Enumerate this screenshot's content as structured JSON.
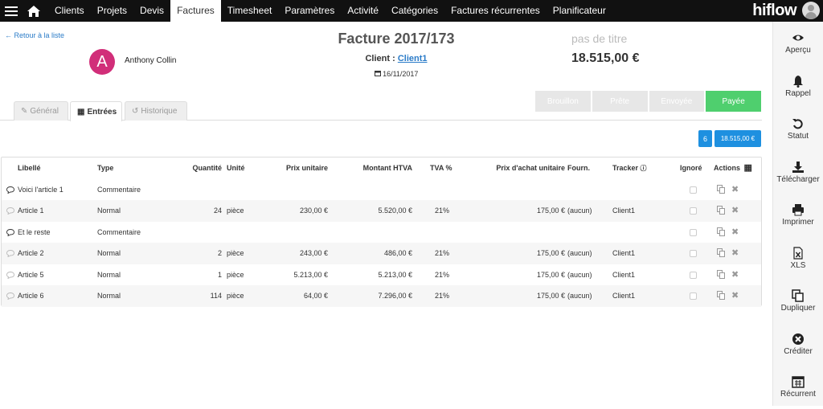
{
  "nav": {
    "tabs": [
      {
        "label": "Clients"
      },
      {
        "label": "Projets"
      },
      {
        "label": "Devis"
      },
      {
        "label": "Factures",
        "active": true
      },
      {
        "label": "Timesheet"
      },
      {
        "label": "Paramètres"
      },
      {
        "label": "Activité"
      },
      {
        "label": "Catégories"
      },
      {
        "label": "Factures récurrentes"
      },
      {
        "label": "Planificateur"
      }
    ],
    "brand": "hiflow"
  },
  "header": {
    "back_label": "Retour à la liste",
    "avatar_letter": "A",
    "contact_name": "Anthony Collin",
    "title": "Facture 2017/173",
    "client_label": "Client :",
    "client_link": "Client1",
    "date": "16/11/2017",
    "no_title": "pas de titre",
    "total": "18.515,00 €"
  },
  "status_steps": [
    {
      "label": "Brouillon",
      "active": false
    },
    {
      "label": "Prête",
      "active": false
    },
    {
      "label": "Envoyée",
      "active": false
    },
    {
      "label": "Payée",
      "active": true
    }
  ],
  "subtabs": {
    "general": "Général",
    "entries": "Entrées",
    "history": "Historique"
  },
  "summary": {
    "count": "6",
    "sum": "18.515,00 €"
  },
  "table": {
    "headers": {
      "libelle": "Libellé",
      "type": "Type",
      "quantite": "Quantité",
      "unite": "Unité",
      "prix_unitaire": "Prix unitaire",
      "montant": "Montant HTVA",
      "tva": "TVA %",
      "prix_achat": "Prix d'achat unitaire",
      "fourn": "Fourn.",
      "tracker": "Tracker",
      "ignore": "Ignoré",
      "actions": "Actions"
    },
    "rows": [
      {
        "libelle": "Voici l'article 1",
        "type": "Commentaire",
        "quantite": "",
        "unite": "",
        "prix_unitaire": "",
        "montant": "",
        "tva": "",
        "prix_achat": "",
        "fourn": "",
        "tracker": ""
      },
      {
        "libelle": "Article 1",
        "type": "Normal",
        "quantite": "24",
        "unite": "pièce",
        "prix_unitaire": "230,00 €",
        "montant": "5.520,00 €",
        "tva": "21%",
        "prix_achat": "175,00 €",
        "fourn": "(aucun)",
        "tracker": "Client1"
      },
      {
        "libelle": "Et le reste",
        "type": "Commentaire",
        "quantite": "",
        "unite": "",
        "prix_unitaire": "",
        "montant": "",
        "tva": "",
        "prix_achat": "",
        "fourn": "",
        "tracker": ""
      },
      {
        "libelle": "Article 2",
        "type": "Normal",
        "quantite": "2",
        "unite": "pièce",
        "prix_unitaire": "243,00 €",
        "montant": "486,00 €",
        "tva": "21%",
        "prix_achat": "175,00 €",
        "fourn": "(aucun)",
        "tracker": "Client1"
      },
      {
        "libelle": "Article 5",
        "type": "Normal",
        "quantite": "1",
        "unite": "pièce",
        "prix_unitaire": "5.213,00 €",
        "montant": "5.213,00 €",
        "tva": "21%",
        "prix_achat": "175,00 €",
        "fourn": "(aucun)",
        "tracker": "Client1"
      },
      {
        "libelle": "Article 6",
        "type": "Normal",
        "quantite": "114",
        "unite": "pièce",
        "prix_unitaire": "64,00 €",
        "montant": "7.296,00 €",
        "tva": "21%",
        "prix_achat": "175,00 €",
        "fourn": "(aucun)",
        "tracker": "Client1"
      }
    ]
  },
  "sidebar": {
    "items": [
      {
        "label": "Aperçu",
        "icon": "eye-icon"
      },
      {
        "label": "Rappel",
        "icon": "bell-icon"
      },
      {
        "label": "Statut",
        "icon": "undo-icon"
      },
      {
        "label": "Télécharger",
        "icon": "download-icon"
      },
      {
        "label": "Imprimer",
        "icon": "print-icon"
      },
      {
        "label": "XLS",
        "icon": "xls-file-icon"
      },
      {
        "label": "Dupliquer",
        "icon": "copy-icon"
      },
      {
        "label": "Créditer",
        "icon": "close-circle-icon"
      },
      {
        "label": "Récurrent",
        "icon": "calendar-icon"
      }
    ]
  },
  "colors": {
    "nav_bg": "#111111",
    "accent_blue": "#1e90e0",
    "paid_green": "#4fcf6e",
    "avatar_pink": "#d12e79"
  }
}
